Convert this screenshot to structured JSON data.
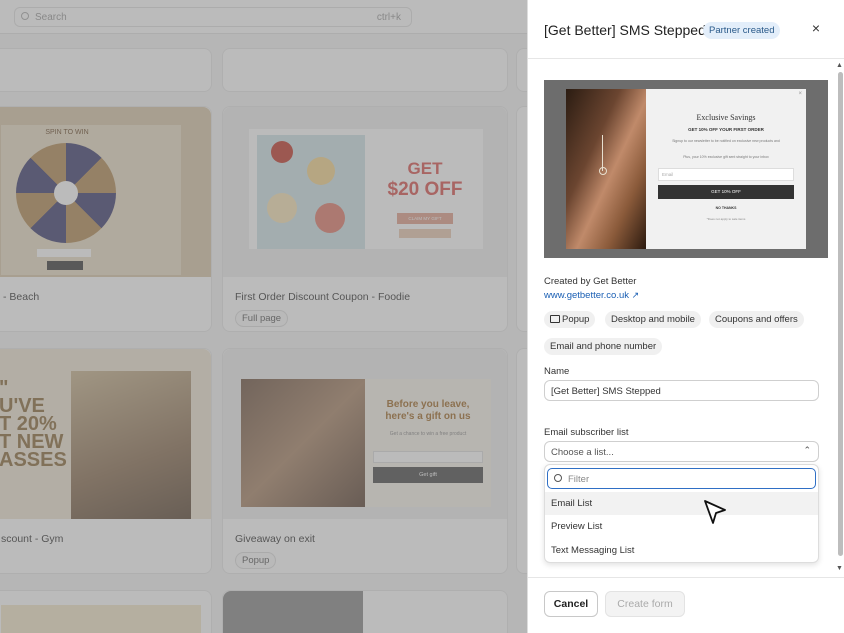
{
  "background": {
    "search_placeholder": "Search",
    "search_shortcut": "ctrl+k",
    "cards": [
      {
        "title": "- Beach",
        "tag": ""
      },
      {
        "title": "First Order Discount Coupon - Foodie",
        "tag": "Full page"
      },
      {
        "title": "scount - Gym",
        "tag": ""
      },
      {
        "title": "Giveaway on exit",
        "tag": "Popup"
      }
    ],
    "thumb_text": {
      "spin": "SPIN TO WIN",
      "get": "GET",
      "off": "$20 OFF",
      "claim": "CLAIM MY GIFT",
      "gym1": "\"",
      "gym2": "U'VE",
      "gym3": "T 20%",
      "gym4": "T NEW",
      "gym5": "ASSES",
      "leave1": "Before you leave,",
      "leave2": "here's a gift on us",
      "leave_sub": "Get a chance to win a free product",
      "giftbtn": "Get gift"
    }
  },
  "panel": {
    "title": "[Get Better] SMS Stepped",
    "badge": "Partner created",
    "close": "×",
    "preview": {
      "heading": "Exclusive Savings",
      "sub": "GET 10% OFF YOUR FIRST ORDER",
      "body1": "Signup to our newsletter to be notified on exclusive new products and",
      "body2": "Plus, your 10% exclusive gift sent straight to your inbox",
      "email": "Email",
      "cta": "GET 10% OFF",
      "decline": "NO THANKS",
      "fine": "*Does not apply to sale items"
    },
    "created_by": "Created by Get Better",
    "website": "www.getbetter.co.uk",
    "tags": [
      "Popup",
      "Desktop and mobile",
      "Coupons and offers",
      "Email and phone number"
    ],
    "name_label": "Name",
    "name_value": "[Get Better] SMS Stepped",
    "list_label": "Email subscriber list",
    "list_placeholder": "Choose a list...",
    "filter_placeholder": "Filter",
    "options": [
      "Email List",
      "Preview List",
      "Text Messaging List"
    ],
    "cancel": "Cancel",
    "create": "Create form"
  },
  "colors": {
    "accent": "#2f6fc5",
    "badge_bg": "#e3eefa",
    "link": "#1a5fb4"
  }
}
